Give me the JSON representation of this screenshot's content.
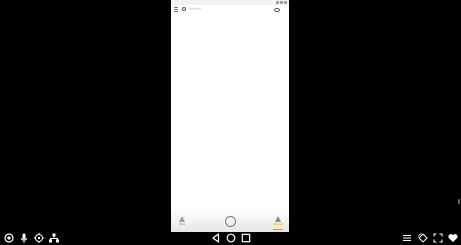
{
  "device": {
    "search": {
      "placeholder": "Search"
    },
    "bottom_nav": [
      {
        "label": "Files",
        "icon": "files-icon",
        "active": false
      },
      {
        "label": "Shared",
        "icon": "shared-icon",
        "active": true
      }
    ]
  },
  "controls": {
    "left": [
      "record-icon",
      "mic-icon",
      "location-icon",
      "network-icon"
    ],
    "center": [
      "back-icon",
      "home-icon",
      "recents-icon"
    ],
    "right": [
      "menu-icon",
      "rotate-icon",
      "fullscreen-icon",
      "favorite-icon"
    ]
  },
  "colors": {
    "background": "#000000",
    "phone_background": "#ffffff",
    "accent": "#d4a017",
    "control_icon": "#ffffff"
  }
}
